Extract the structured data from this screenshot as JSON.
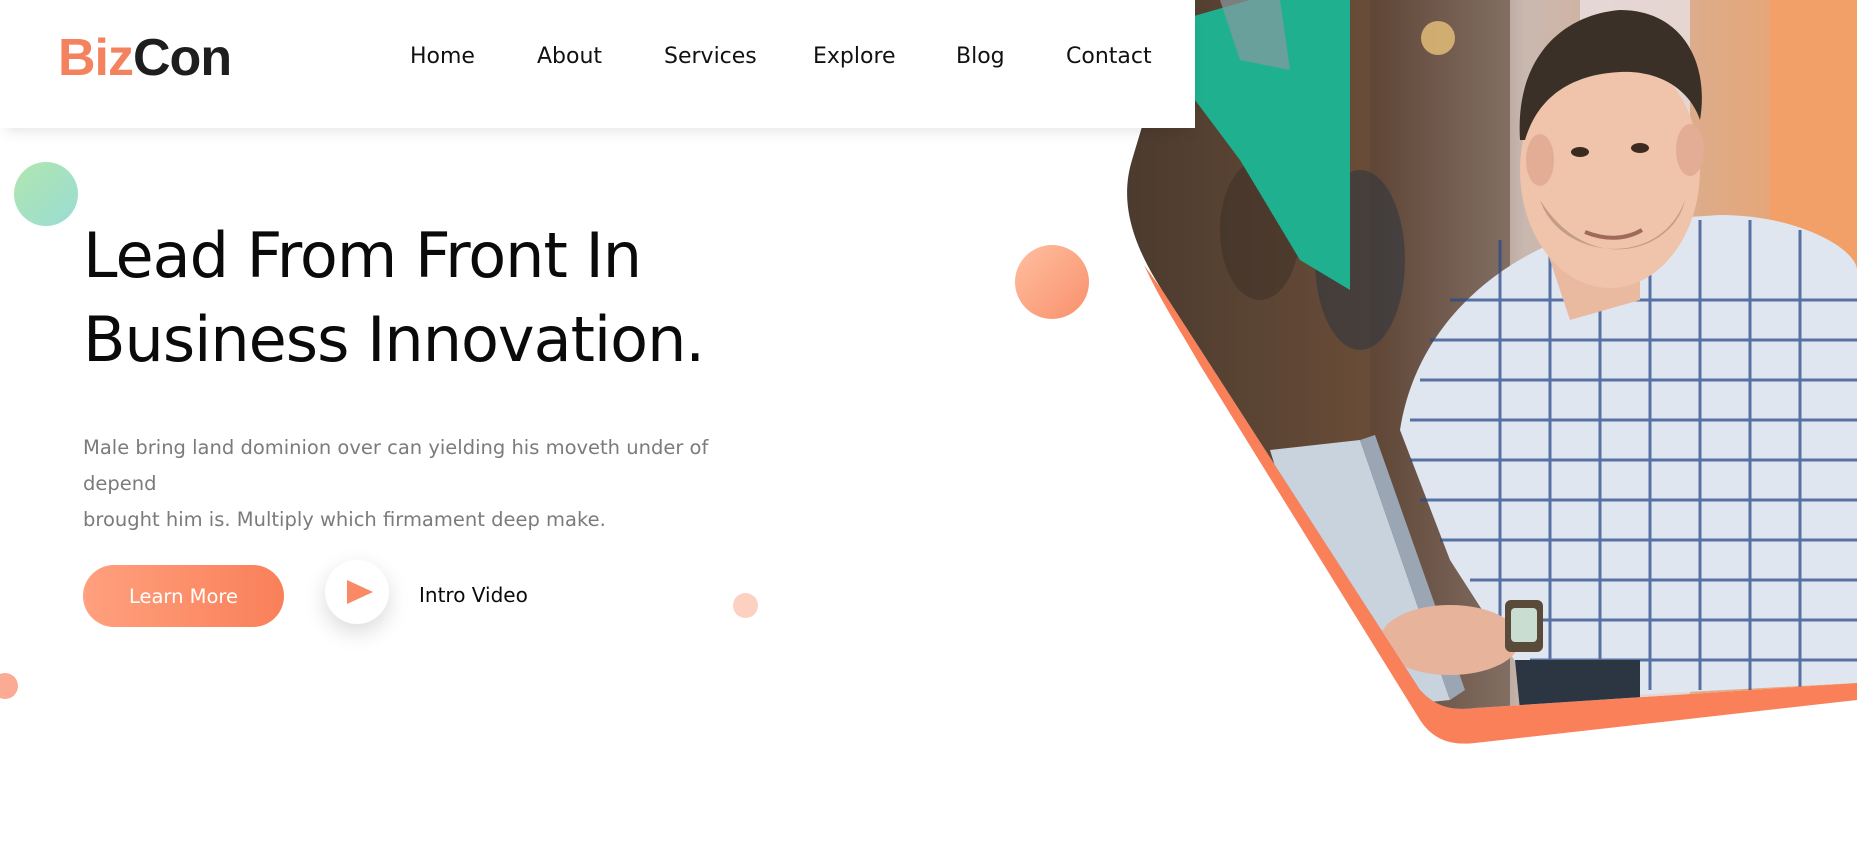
{
  "brand": {
    "part1": "Biz",
    "part2": "Con",
    "accent": "#f4825f"
  },
  "nav": {
    "items": [
      {
        "label": "Home"
      },
      {
        "label": "About"
      },
      {
        "label": "Services"
      },
      {
        "label": "Explore"
      },
      {
        "label": "Blog"
      },
      {
        "label": "Contact"
      }
    ]
  },
  "hero": {
    "title_line1": "Lead From Front In",
    "title_line2": "Business Innovation.",
    "desc_line1": "Male bring land dominion over can yielding his moveth under of depend",
    "desc_line2": "brought him is. Multiply which firmament deep make.",
    "cta_label": "Learn More",
    "video_label": "Intro Video",
    "video_icon": "play-icon",
    "image_subject": "man-with-laptop"
  },
  "colors": {
    "accent": "#f98059",
    "accent_light": "#ffa07e",
    "text_muted": "#7b7b7b"
  }
}
